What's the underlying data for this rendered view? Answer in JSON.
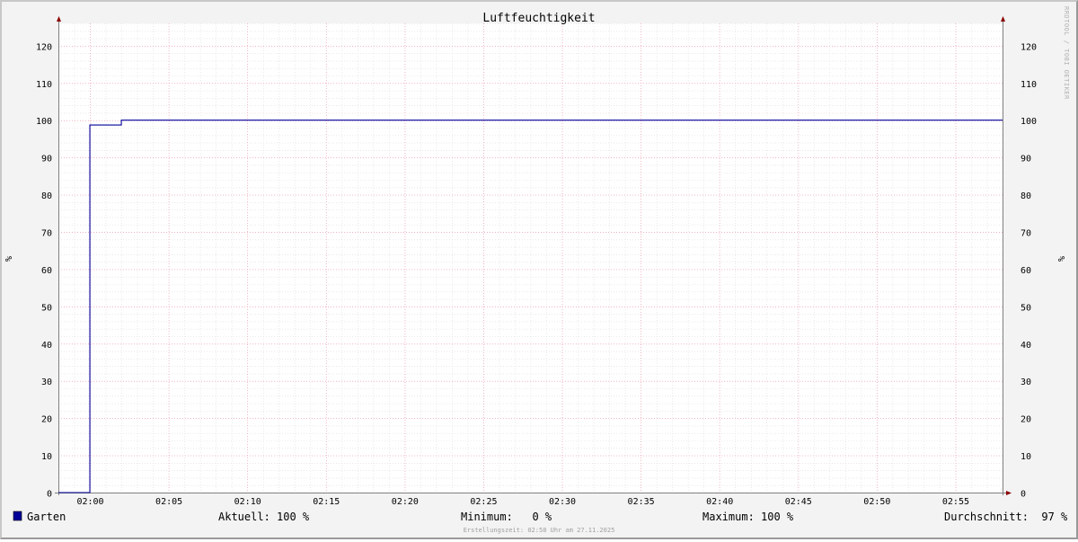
{
  "colors": {
    "canvas": "#f3f3f3",
    "plot_background": "#ffffff",
    "minor_grid": "#dcdcdc",
    "major_grid": "#f0a0b0",
    "axis": "#808080",
    "arrow": "#8b0000",
    "series": "#000099"
  },
  "watermark": "RRDTOOL / TOBI OETIKER",
  "legend": {
    "swatch_color": "#000099",
    "series_label": "Garten",
    "current": "Aktuell: 100 %",
    "minimum": "Minimum:   0 %",
    "maximum": "Maximum: 100 %",
    "average": "Durchschnitt:  97 %"
  },
  "footer": "Erstellungszeit: 02:58 Uhr am 27.11.2025",
  "chart_data": {
    "type": "line",
    "title": "Luftfeuchtigkeit",
    "xlabel": "",
    "ylabel": "%",
    "ylabel_right": "%",
    "xlim": [
      "01:58",
      "02:58"
    ],
    "ylim": [
      0,
      126
    ],
    "yticks": [
      0,
      10,
      20,
      30,
      40,
      50,
      60,
      70,
      80,
      90,
      100,
      110,
      120
    ],
    "xticks": [
      "02:00",
      "02:05",
      "02:10",
      "02:15",
      "02:20",
      "02:25",
      "02:30",
      "02:35",
      "02:40",
      "02:45",
      "02:50",
      "02:55"
    ],
    "grid": true,
    "legend_position": "bottom",
    "series": [
      {
        "name": "Garten",
        "color": "#000099",
        "step": true,
        "x": [
          "01:58",
          "02:00",
          "02:02",
          "02:58"
        ],
        "y": [
          0,
          98.7,
          100,
          100
        ]
      }
    ]
  }
}
